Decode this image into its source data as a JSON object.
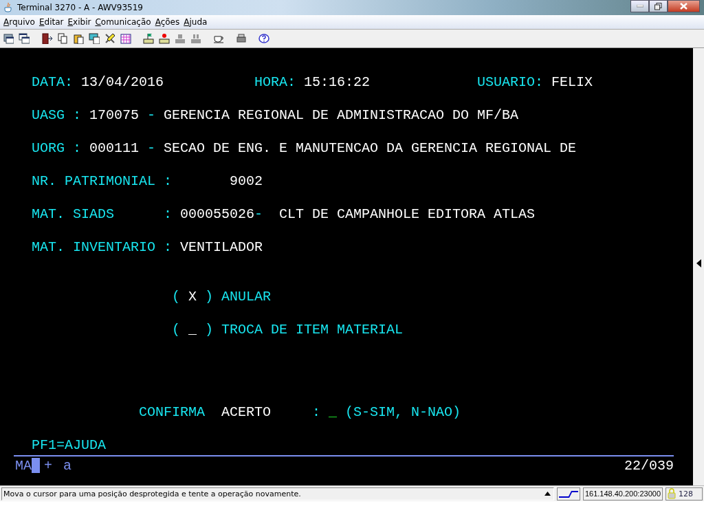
{
  "window": {
    "title": "Terminal 3270 - A - AWV93519"
  },
  "menu": [
    "Arquivo",
    "Editar",
    "Exibir",
    "Comunicação",
    "Ações",
    "Ajuda"
  ],
  "screen": {
    "lines": [
      {
        "segments": [
          {
            "text": "DATA:",
            "kind": "label"
          },
          {
            "text": "13/04/2016",
            "kind": "value"
          },
          {
            "text": "HORA:",
            "kind": "label"
          },
          {
            "text": "15:16:22",
            "kind": "value"
          },
          {
            "text": "USUARIO:",
            "kind": "label"
          },
          {
            "text": "FELIX",
            "kind": "value"
          }
        ]
      },
      {
        "segments": [
          {
            "text": "UASG :",
            "kind": "label"
          },
          {
            "text": "170075",
            "kind": "value"
          },
          {
            "text": "-",
            "kind": "label"
          },
          {
            "text": "GERENCIA REGIONAL DE ADMINISTRACAO DO MF/BA",
            "kind": "value"
          }
        ]
      },
      {
        "segments": [
          {
            "text": "UORG :",
            "kind": "label"
          },
          {
            "text": "000111",
            "kind": "value"
          },
          {
            "text": "-",
            "kind": "label"
          },
          {
            "text": "SECAO DE ENG. E MANUTENCAO DA GERENCIA REGIONAL DE",
            "kind": "value"
          }
        ]
      },
      {
        "segments": [
          {
            "text": "NR. PATRIMONIAL :",
            "kind": "label"
          },
          {
            "text": "9002",
            "kind": "value"
          }
        ]
      },
      {
        "segments": [
          {
            "text": "MAT. SIADS",
            "kind": "label"
          },
          {
            "text": ":",
            "kind": "label"
          },
          {
            "text": "000055026",
            "kind": "value"
          },
          {
            "text": "-",
            "kind": "label"
          },
          {
            "text": "CLT DE CAMPANHOLE EDITORA ATLAS",
            "kind": "value"
          }
        ]
      },
      {
        "segments": [
          {
            "text": "MAT. INVENTARIO :",
            "kind": "label"
          },
          {
            "text": "VENTILADOR",
            "kind": "value"
          }
        ]
      },
      {
        "segments": [
          {
            "text": "(",
            "kind": "label"
          },
          {
            "text": "X",
            "kind": "value"
          },
          {
            "text": ")",
            "kind": "label"
          },
          {
            "text": "ANULAR",
            "kind": "label"
          }
        ]
      },
      {
        "segments": [
          {
            "text": "(",
            "kind": "label"
          },
          {
            "text": "_",
            "kind": "value"
          },
          {
            "text": ")",
            "kind": "label"
          },
          {
            "text": "TROCA DE ITEM MATERIAL",
            "kind": "label"
          }
        ]
      },
      {
        "segments": [
          {
            "text": "CONFIRMA",
            "kind": "label"
          },
          {
            "text": "ACERTO",
            "kind": "value"
          },
          {
            "text": ":",
            "kind": "label"
          },
          {
            "text": "_",
            "kind": "input"
          },
          {
            "text": "(S-SIM, N-NAO)",
            "kind": "label"
          }
        ]
      },
      {
        "segments": [
          {
            "text": "PF1=AJUDA",
            "kind": "label"
          }
        ]
      }
    ]
  },
  "oia": {
    "indicators": [
      "MA",
      "+",
      "a"
    ],
    "cursor_position": "22/039"
  },
  "status_bar": {
    "message": "Mova o cursor para uma posição desprotegida e tente a operação novamente.",
    "address": "161.148.40.200:23000",
    "encryption": "128"
  }
}
